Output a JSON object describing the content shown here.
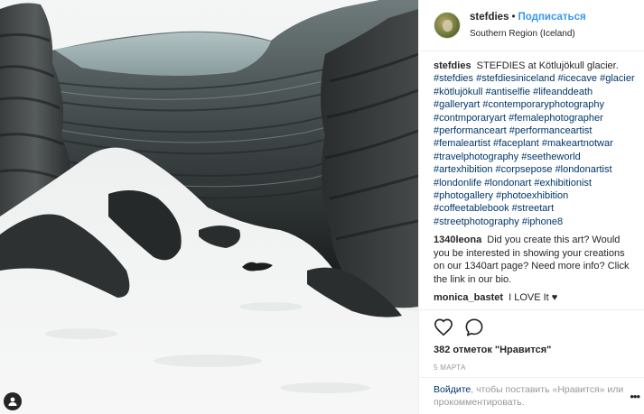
{
  "post": {
    "username": "stefdies",
    "follow_label": "Подписаться",
    "location": "Southern Region (Iceland)",
    "caption_user": "stefdies",
    "caption_text": "STEFDIES at Kötlujökull glacier.",
    "hashtags": [
      "#stefdies",
      "#stefdiesiniceland",
      "#icecave",
      "#glacier",
      "#kötlujökull",
      "#antiselfie",
      "#lifeanddeath",
      "#galleryart",
      "#contemporaryphotography",
      "#contmporaryart",
      "#femalephotographer",
      "#performanceart",
      "#performanceartist",
      "#femaleartist",
      "#faceplant",
      "#makeartnotwar",
      "#travelphotography",
      "#seetheworld",
      "#artexhibition",
      "#corpsepose",
      "#londonartist",
      "#londonlife",
      "#londonart",
      "#exhibitionist",
      "#photogallery",
      "#photoexhibition",
      "#coffeetablebook",
      "#streetart",
      "#streetphotography",
      "#iphone8"
    ],
    "comments": [
      {
        "user": "1340leona",
        "text": "Did you create this art? Would you be interested in showing your creations on our 1340art page? Need more info? Click the link in our bio."
      },
      {
        "user": "monica_bastet",
        "text": "I LOVE It ♥"
      }
    ],
    "likes_text": "382 отметок \"Нравится\"",
    "date": "5 МАРТА",
    "add_comment": {
      "login_label": "Войдите",
      "rest": ", чтобы поставить «Нравится» или прокомментировать."
    },
    "more_label": "•••",
    "icons": {
      "like": "heart-icon",
      "comment": "comment-bubble-icon",
      "user_tag": "user-tag-icon"
    }
  }
}
